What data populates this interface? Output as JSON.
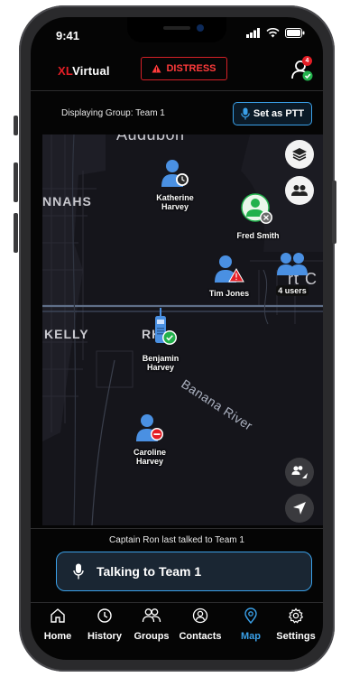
{
  "status_bar": {
    "time": "9:41"
  },
  "header": {
    "brand_prefix": "XL",
    "brand_suffix": "Virtual",
    "distress_label": "DISTRESS",
    "notification_count": "4"
  },
  "group_row": {
    "text": "Displaying Group: Team 1",
    "ptt_label": "Set as PTT"
  },
  "map": {
    "labels": [
      "Audubon",
      "NNAHS",
      "rt C",
      "KELLY",
      "RK",
      "Banana River"
    ],
    "users": [
      {
        "name_line1": "Katherine",
        "name_line2": "Harvey",
        "status": "clock"
      },
      {
        "name_line1": "Fred Smith",
        "name_line2": "",
        "status": "offline"
      },
      {
        "name_line1": "Tim Jones",
        "name_line2": "",
        "status": "warning"
      },
      {
        "name_line1": "4 users",
        "name_line2": "",
        "status": "group"
      },
      {
        "name_line1": "Benjamin",
        "name_line2": "Harvey",
        "status": "radio-ok"
      },
      {
        "name_line1": "Caroline",
        "name_line2": "Harvey",
        "status": "busy"
      }
    ]
  },
  "last_talk": "Captain Ron last talked to Team 1",
  "talk_bar": {
    "label": "Talking to Team 1"
  },
  "tabs": [
    {
      "label": "Home",
      "icon": "home-icon",
      "active": false
    },
    {
      "label": "History",
      "icon": "clock-icon",
      "active": false
    },
    {
      "label": "Groups",
      "icon": "groups-icon",
      "active": false
    },
    {
      "label": "Contacts",
      "icon": "contacts-icon",
      "active": false
    },
    {
      "label": "Map",
      "icon": "map-pin-icon",
      "active": true
    },
    {
      "label": "Settings",
      "icon": "gear-icon",
      "active": false
    }
  ],
  "colors": {
    "accent": "#3aa0e8",
    "distress": "#e31e26",
    "online": "#22b14c",
    "background": "#050505"
  }
}
